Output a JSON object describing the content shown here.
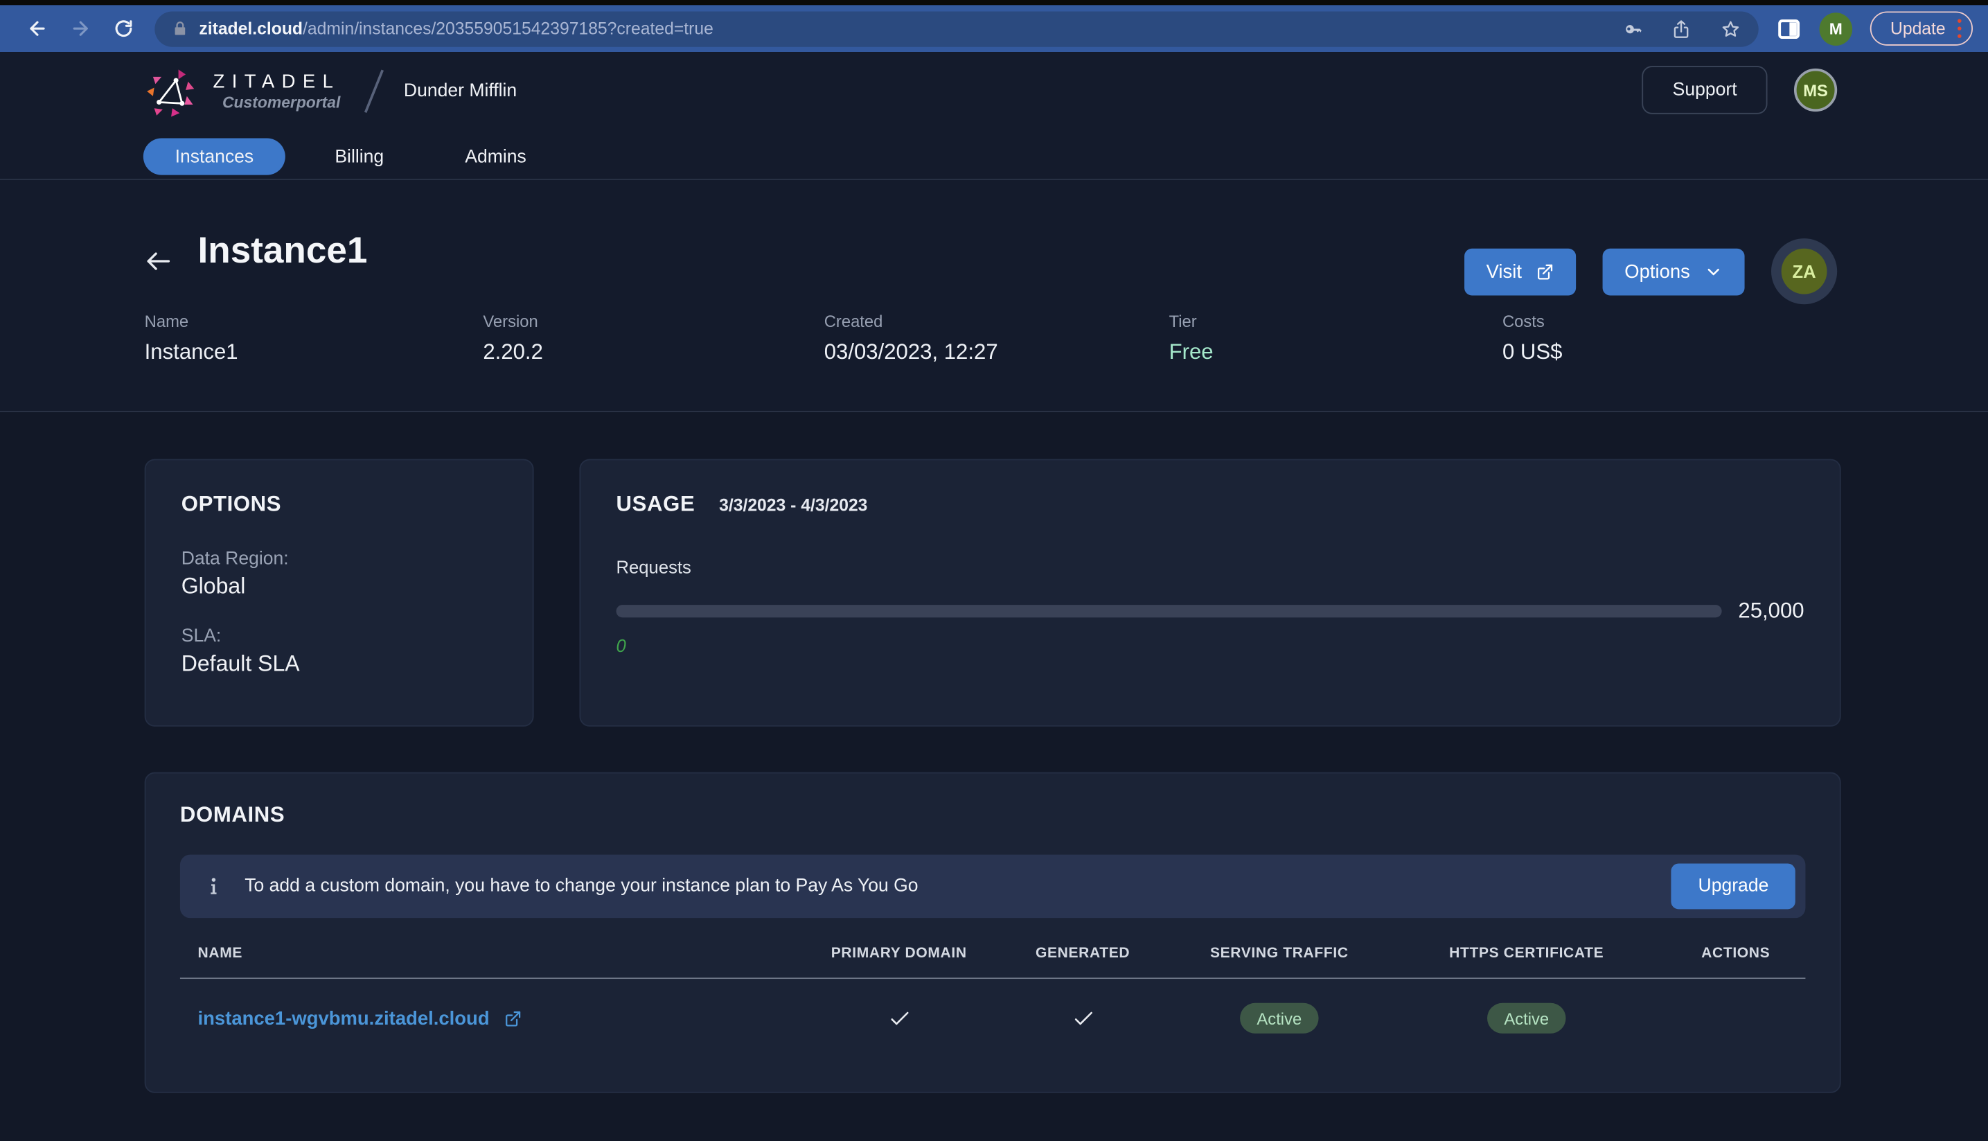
{
  "browser": {
    "url": {
      "host": "zitadel.cloud",
      "path": "/admin/instances/203559051542397185?created=true"
    },
    "profile_initial": "M",
    "update_label": "Update"
  },
  "header": {
    "brand": "ZITADEL",
    "brand_subtitle": "Customerportal",
    "org_name": "Dunder Mifflin",
    "support_label": "Support",
    "user_initials": "MS",
    "tabs": [
      {
        "label": "Instances",
        "active": true
      },
      {
        "label": "Billing",
        "active": false
      },
      {
        "label": "Admins",
        "active": false
      }
    ]
  },
  "instance": {
    "title": "Instance1",
    "visit_label": "Visit",
    "options_label": "Options",
    "avatar_initials": "ZA",
    "meta": [
      {
        "label": "Name",
        "value": "Instance1"
      },
      {
        "label": "Version",
        "value": "2.20.2"
      },
      {
        "label": "Created",
        "value": "03/03/2023, 12:27"
      },
      {
        "label": "Tier",
        "value": "Free"
      },
      {
        "label": "Costs",
        "value": "0 US$"
      }
    ]
  },
  "options_card": {
    "title": "OPTIONS",
    "fields": [
      {
        "label": "Data Region:",
        "value": "Global"
      },
      {
        "label": "SLA:",
        "value": "Default SLA"
      }
    ]
  },
  "usage_card": {
    "title": "USAGE",
    "period": "3/3/2023 - 4/3/2023",
    "metric_label": "Requests",
    "current": "0",
    "limit": "25,000"
  },
  "domains_card": {
    "title": "DOMAINS",
    "notice_text": "To add a custom domain, you have to change your instance plan to Pay As You Go",
    "upgrade_label": "Upgrade",
    "table": {
      "columns": [
        "NAME",
        "PRIMARY DOMAIN",
        "GENERATED",
        "SERVING TRAFFIC",
        "HTTPS CERTIFICATE",
        "ACTIONS"
      ],
      "rows": [
        {
          "name": "instance1-wgvbmu.zitadel.cloud",
          "primary_domain": true,
          "generated": true,
          "serving_traffic": "Active",
          "https_certificate": "Active"
        }
      ]
    }
  },
  "colors": {
    "accent_blue": "#3d78c9",
    "link_blue": "#4b96d9",
    "tier_free_green": "#a5e8cb",
    "usage_green": "#3fa44c",
    "badge_bg": "#3d5746",
    "badge_text": "#b5e3c2",
    "chrome_bg": "#33599e",
    "urlbar_bg": "#2b4a7f",
    "page_bg": "#121827",
    "card_bg": "#1b2336",
    "notice_bg": "#293451"
  }
}
